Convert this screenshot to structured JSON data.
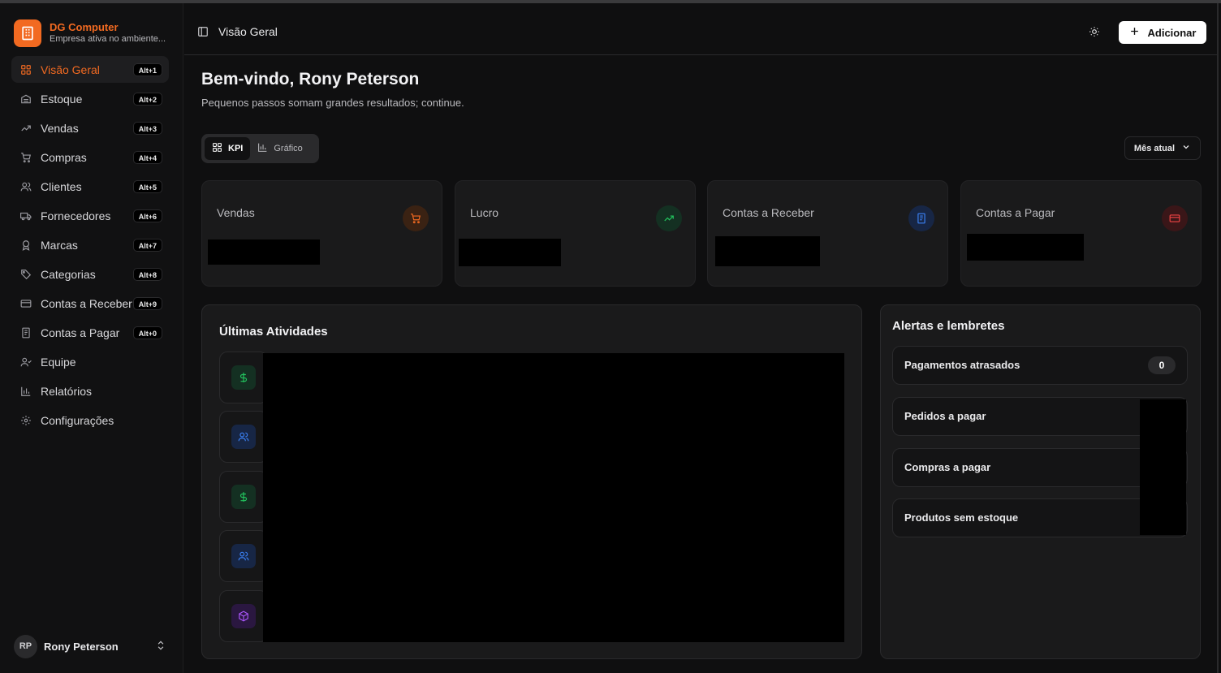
{
  "brand": {
    "name": "DG Computer",
    "subtitle": "Empresa ativa no ambiente..."
  },
  "sidebar": {
    "items": [
      {
        "label": "Visão Geral",
        "shortcut": "Alt+1",
        "icon": "grid-icon",
        "active": true
      },
      {
        "label": "Estoque",
        "shortcut": "Alt+2",
        "icon": "warehouse-icon"
      },
      {
        "label": "Vendas",
        "shortcut": "Alt+3",
        "icon": "trending-up-icon"
      },
      {
        "label": "Compras",
        "shortcut": "Alt+4",
        "icon": "cart-icon"
      },
      {
        "label": "Clientes",
        "shortcut": "Alt+5",
        "icon": "users-icon"
      },
      {
        "label": "Fornecedores",
        "shortcut": "Alt+6",
        "icon": "truck-icon"
      },
      {
        "label": "Marcas",
        "shortcut": "Alt+7",
        "icon": "award-icon"
      },
      {
        "label": "Categorias",
        "shortcut": "Alt+8",
        "icon": "tags-icon"
      },
      {
        "label": "Contas a Receber",
        "shortcut": "Alt+9",
        "icon": "credit-card-icon"
      },
      {
        "label": "Contas a Pagar",
        "shortcut": "Alt+0",
        "icon": "receipt-icon"
      },
      {
        "label": "Equipe",
        "shortcut": "",
        "icon": "team-icon"
      },
      {
        "label": "Relatórios",
        "shortcut": "",
        "icon": "bar-chart-icon"
      },
      {
        "label": "Configurações",
        "shortcut": "",
        "icon": "settings-icon"
      }
    ],
    "user": {
      "initials": "RP",
      "name": "Rony Peterson"
    }
  },
  "header": {
    "title": "Visão Geral",
    "add_label": "Adicionar"
  },
  "main": {
    "welcome": "Bem-vindo, Rony Peterson",
    "subtitle": "Pequenos passos somam grandes resultados; continue.",
    "view_toggle": {
      "kpi_label": "KPI",
      "chart_label": "Gráfico",
      "selected": "KPI"
    },
    "period_select": "Mês atual",
    "kpis": [
      {
        "label": "Vendas",
        "icon": "cart-icon",
        "color": "#f26a21"
      },
      {
        "label": "Lucro",
        "icon": "trending-up-icon",
        "color": "#22c55e"
      },
      {
        "label": "Contas a Receber",
        "icon": "receipt-icon",
        "color": "#3b82f6"
      },
      {
        "label": "Contas a Pagar",
        "icon": "credit-card-icon",
        "color": "#ef4444"
      }
    ],
    "activities": {
      "title": "Últimas Atividades",
      "items": [
        {
          "icon": "dollar-icon",
          "color": "#22c55e"
        },
        {
          "icon": "users-icon",
          "color": "#3b82f6"
        },
        {
          "icon": "dollar-icon",
          "color": "#22c55e"
        },
        {
          "icon": "users-icon",
          "color": "#3b82f6"
        },
        {
          "icon": "box-icon",
          "color": "#a855f7"
        }
      ]
    },
    "alerts": {
      "title": "Alertas e lembretes",
      "items": [
        {
          "label": "Pagamentos atrasados",
          "count": "0"
        },
        {
          "label": "Pedidos a pagar"
        },
        {
          "label": "Compras a pagar"
        },
        {
          "label": "Produtos sem estoque"
        }
      ]
    }
  },
  "colors": {
    "accent": "#f26a21",
    "background": "#0f0f10",
    "card": "#1a1a1b"
  }
}
